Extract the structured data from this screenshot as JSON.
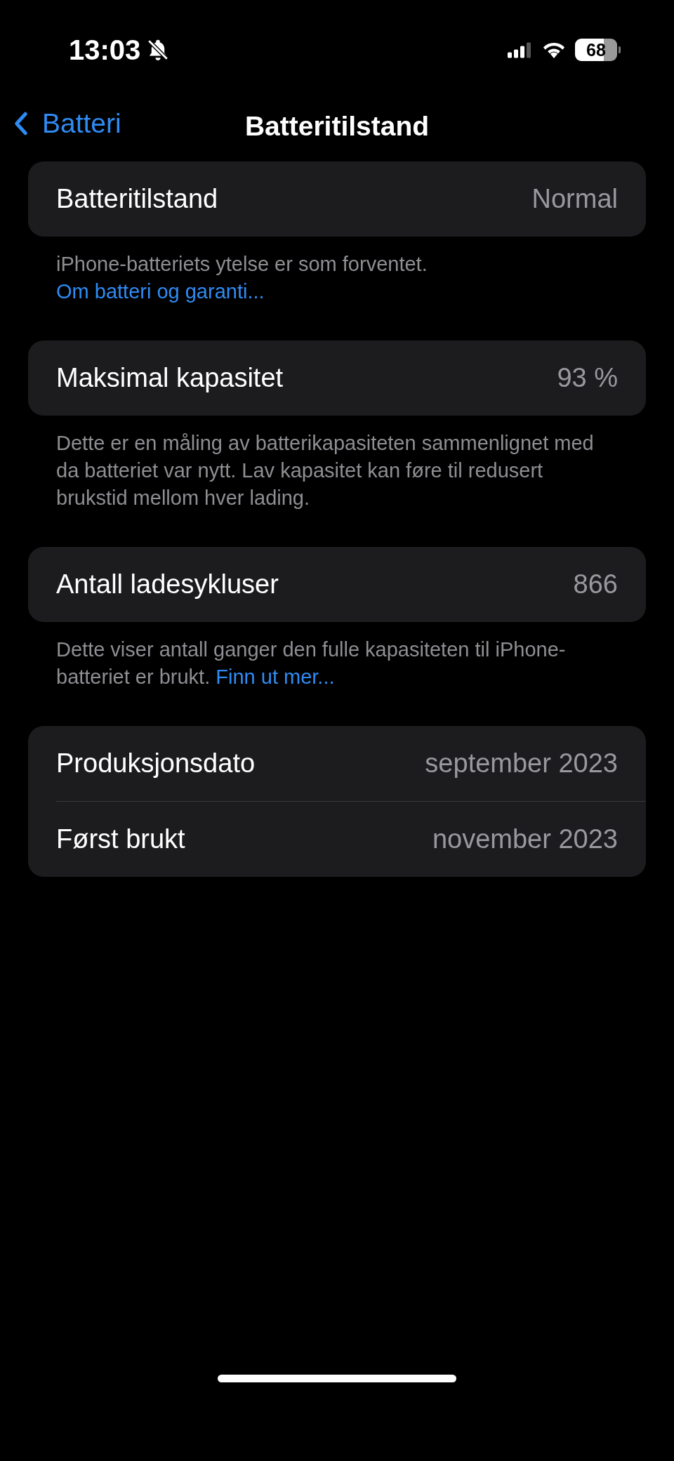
{
  "status_bar": {
    "time": "13:03",
    "battery": "68"
  },
  "nav": {
    "back": "Batteri",
    "title": "Batteritilstand"
  },
  "sections": [
    {
      "rows": [
        {
          "label": "Batteritilstand",
          "value": "Normal"
        }
      ],
      "footer": {
        "text": "iPhone-batteriets ytelse er som forventet.",
        "link": "Om batteri og garanti..."
      }
    },
    {
      "rows": [
        {
          "label": "Maksimal kapasitet",
          "value": "93 %"
        }
      ],
      "footer": {
        "text": "Dette er en måling av batterikapasiteten sammenlignet med da batteriet var nytt. Lav kapasitet kan føre til redusert brukstid mellom hver lading."
      }
    },
    {
      "rows": [
        {
          "label": "Antall ladesykluser",
          "value": "866"
        }
      ],
      "footer": {
        "text": "Dette viser antall ganger den fulle kapasiteten til iPhone-batteriet er brukt.",
        "link": "Finn ut mer..."
      }
    },
    {
      "rows": [
        {
          "label": "Produksjonsdato",
          "value": "september 2023"
        },
        {
          "label": "Først brukt",
          "value": "november 2023"
        }
      ]
    }
  ]
}
